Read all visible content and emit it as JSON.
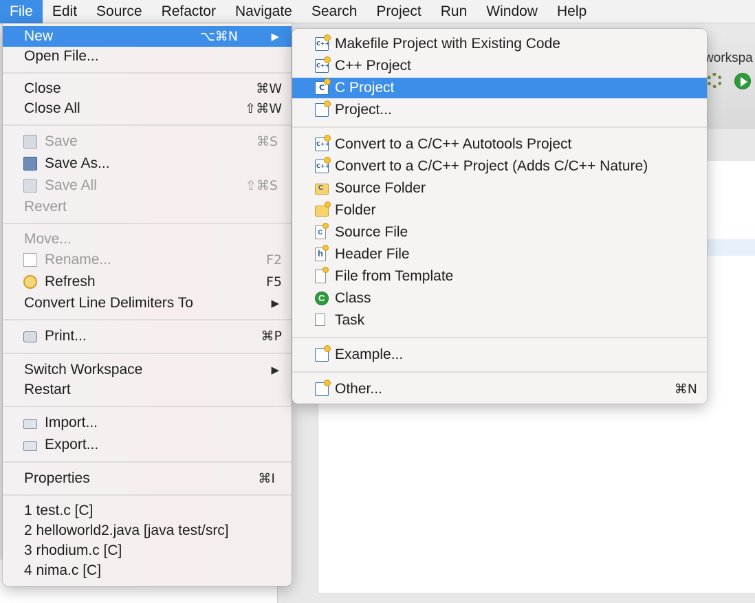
{
  "menubar": {
    "items": [
      "File",
      "Edit",
      "Source",
      "Refactor",
      "Navigate",
      "Search",
      "Project",
      "Run",
      "Window",
      "Help"
    ]
  },
  "ide": {
    "workspace_label": "workspa"
  },
  "file_menu": {
    "new": {
      "label": "New",
      "shortcut": "⌥⌘N"
    },
    "open_file": {
      "label": "Open File..."
    },
    "close": {
      "label": "Close",
      "shortcut": "⌘W"
    },
    "close_all": {
      "label": "Close All",
      "shortcut": "⇧⌘W"
    },
    "save": {
      "label": "Save",
      "shortcut": "⌘S"
    },
    "save_as": {
      "label": "Save As..."
    },
    "save_all": {
      "label": "Save All",
      "shortcut": "⇧⌘S"
    },
    "revert": {
      "label": "Revert"
    },
    "move": {
      "label": "Move..."
    },
    "rename": {
      "label": "Rename...",
      "shortcut": "F2"
    },
    "refresh": {
      "label": "Refresh",
      "shortcut": "F5"
    },
    "convert_line_delimiters": {
      "label": "Convert Line Delimiters To"
    },
    "print": {
      "label": "Print...",
      "shortcut": "⌘P"
    },
    "switch_workspace": {
      "label": "Switch Workspace"
    },
    "restart": {
      "label": "Restart"
    },
    "import": {
      "label": "Import..."
    },
    "export": {
      "label": "Export..."
    },
    "properties": {
      "label": "Properties",
      "shortcut": "⌘I"
    },
    "recent": [
      "1 test.c  [C]",
      "2 helloworld2.java  [java  test/src]",
      "3 rhodium.c  [C]",
      "4 nima.c  [C]"
    ]
  },
  "new_submenu": {
    "makefile_project": {
      "label": "Makefile Project with Existing Code"
    },
    "cpp_project": {
      "label": "C++ Project"
    },
    "c_project": {
      "label": "C Project"
    },
    "project": {
      "label": "Project..."
    },
    "convert_autotools": {
      "label": "Convert to a C/C++ Autotools Project"
    },
    "convert_nature": {
      "label": "Convert to a C/C++ Project (Adds C/C++ Nature)"
    },
    "source_folder": {
      "label": "Source Folder"
    },
    "folder": {
      "label": "Folder"
    },
    "source_file": {
      "label": "Source File"
    },
    "header_file": {
      "label": "Header File"
    },
    "file_from_template": {
      "label": "File from Template"
    },
    "class": {
      "label": "Class"
    },
    "task": {
      "label": "Task"
    },
    "example": {
      "label": "Example..."
    },
    "other": {
      "label": "Other...",
      "shortcut": "⌘N"
    }
  },
  "colors": {
    "highlight": "#3d8ee8",
    "menu_bg": "#f4f1f1",
    "disabled_text": "#9a9a9a"
  }
}
